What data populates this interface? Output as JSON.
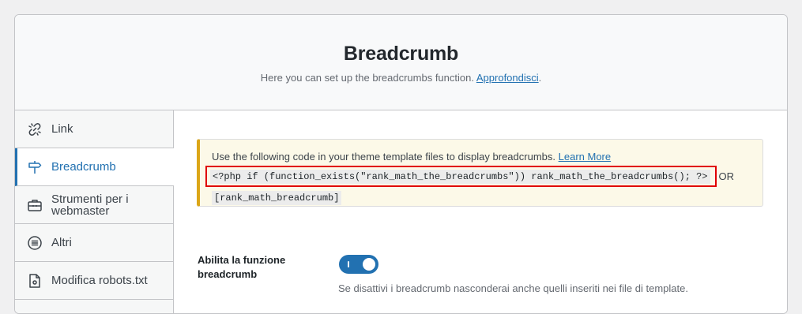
{
  "header": {
    "title": "Breadcrumb",
    "description": "Here you can set up the breadcrumbs function.",
    "learn_link": "Approfondisci",
    "description_end": "."
  },
  "sidebar": {
    "items": [
      {
        "label": "Link",
        "icon": "link-icon"
      },
      {
        "label": "Breadcrumb",
        "icon": "signpost-icon",
        "active": true
      },
      {
        "label": "Strumenti per i webmaster",
        "icon": "toolbox-icon"
      },
      {
        "label": "Altri",
        "icon": "list-circle-icon"
      },
      {
        "label": "Modifica robots.txt",
        "icon": "file-icon"
      }
    ]
  },
  "notice": {
    "text": "Use the following code in your theme template files to display breadcrumbs.",
    "learn_more": "Learn More",
    "php_code": "<?php if (function_exists(\"rank_math_the_breadcrumbs\")) rank_math_the_breadcrumbs(); ?>",
    "or": "OR",
    "shortcode": "[rank_math_breadcrumb]"
  },
  "setting": {
    "label": "Abilita la funzione breadcrumb",
    "enabled": true,
    "description": "Se disattivi i breadcrumb nasconderai anche quelli inseriti nei file di template."
  },
  "colors": {
    "accent": "#2271b1",
    "notice_border": "#dba617",
    "highlight": "#e00000"
  }
}
